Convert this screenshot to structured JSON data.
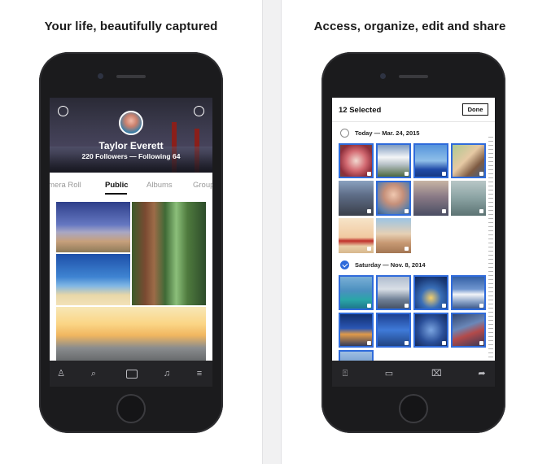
{
  "left_panel": {
    "headline": "Your life, beautifully captured",
    "profile": {
      "name": "Taylor Everett",
      "stats": "220 Followers — Following 64"
    },
    "tabs": [
      {
        "label": "Camera Roll",
        "active": false
      },
      {
        "label": "Public",
        "active": true
      },
      {
        "label": "Albums",
        "active": false
      },
      {
        "label": "Groups",
        "active": false
      }
    ],
    "bottom_nav": [
      {
        "icon": "person-icon"
      },
      {
        "icon": "search-icon"
      },
      {
        "icon": "camera-icon"
      },
      {
        "icon": "bell-icon"
      },
      {
        "icon": "menu-icon"
      }
    ]
  },
  "right_panel": {
    "headline": "Access, organize, edit and share",
    "header": {
      "title": "12 Selected",
      "done_label": "Done"
    },
    "sections": [
      {
        "label": "Today — Mar. 24, 2015",
        "checked": false
      },
      {
        "label": "Saturday — Nov. 8, 2014",
        "checked": true
      }
    ],
    "action_bar": [
      {
        "icon": "share-box-icon"
      },
      {
        "icon": "album-icon"
      },
      {
        "icon": "trash-icon"
      },
      {
        "icon": "forward-icon"
      }
    ]
  },
  "colors": {
    "accent": "#2f6bdb",
    "dark_bar": "#242427"
  }
}
